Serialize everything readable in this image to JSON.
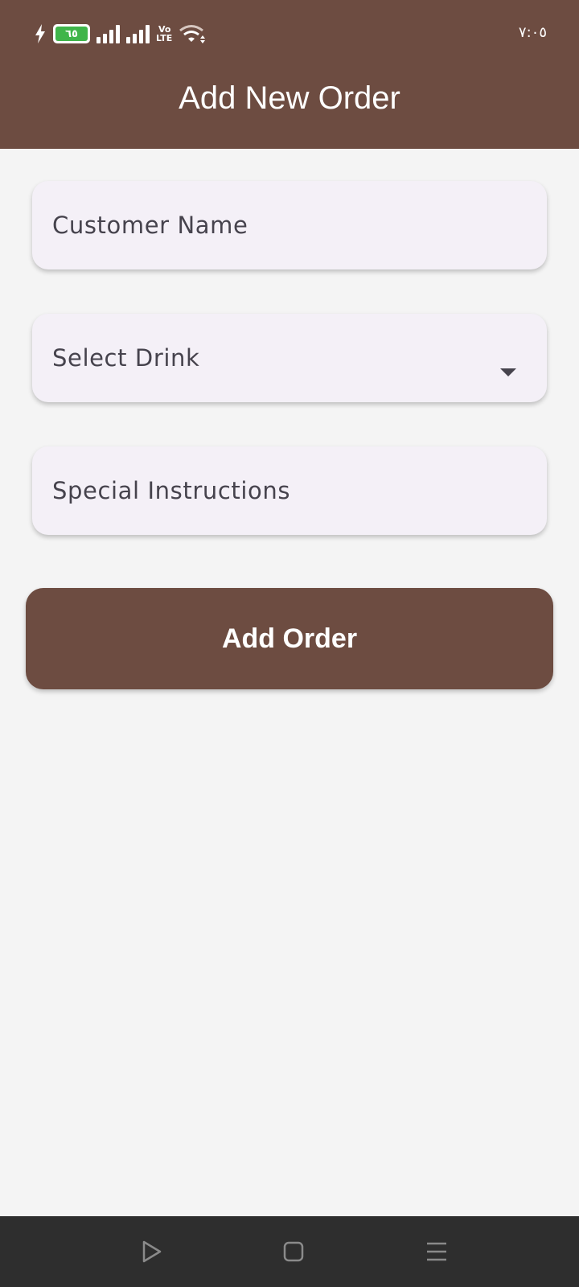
{
  "status_bar": {
    "battery_level": "٦٥",
    "network": "Vo LTE",
    "time": "٧:٠٥",
    "colors": {
      "battery_fill": "#3fb54a"
    }
  },
  "app_bar": {
    "title": "Add New Order",
    "background": "#6d4c41"
  },
  "form": {
    "customer_name_label": "Customer Name",
    "drink_select_label": "Select Drink",
    "special_instructions_label": "Special Instructions"
  },
  "actions": {
    "add_order_label": "Add Order"
  },
  "nav_bar": {
    "icons": [
      "back-triangle-icon",
      "home-square-icon",
      "recents-menu-icon"
    ]
  }
}
